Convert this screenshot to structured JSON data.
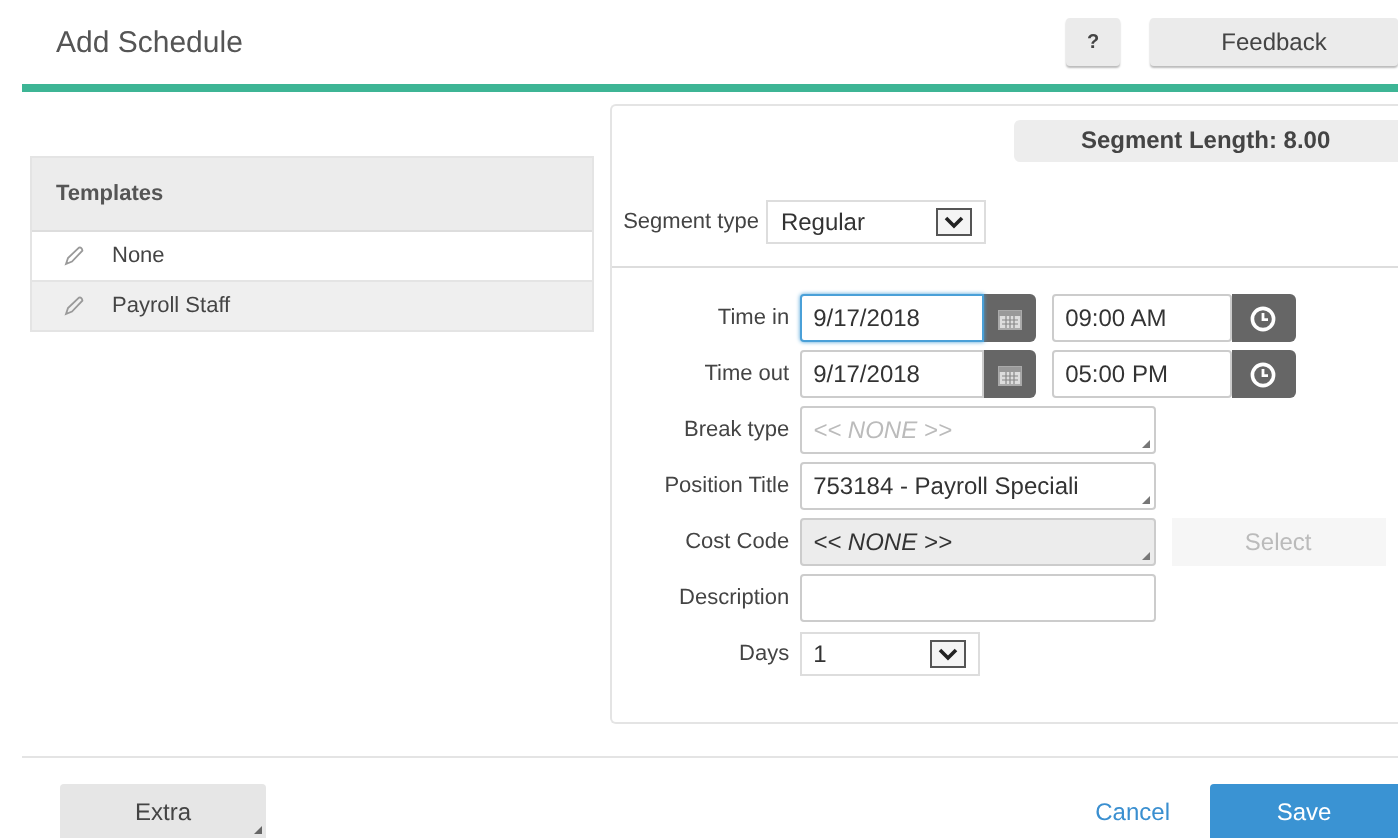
{
  "header": {
    "title": "Add Schedule",
    "help_button": "?",
    "feedback_button": "Feedback"
  },
  "templates": {
    "heading": "Templates",
    "items": [
      {
        "label": "None",
        "highlighted": true
      },
      {
        "label": "Payroll Staff",
        "highlighted": false
      }
    ]
  },
  "form": {
    "segment_length": "Segment Length: 8.00",
    "segment_type": {
      "label": "Segment type",
      "value": "Regular"
    },
    "rows": [
      {
        "kind": "datetime",
        "label": "Time in",
        "date": "9/17/2018",
        "time": "09:00 AM",
        "focused": true
      },
      {
        "kind": "datetime",
        "label": "Time out",
        "date": "9/17/2018",
        "time": "05:00 PM",
        "focused": false
      },
      {
        "kind": "lookup",
        "label": "Break type",
        "placeholder": "<< NONE >>",
        "disabled": false
      },
      {
        "kind": "lookup",
        "label": "Position Title",
        "value": "753184 - Payroll Speciali",
        "disabled": false
      },
      {
        "kind": "lookup",
        "label": "Cost Code",
        "value": "<< NONE >>",
        "disabled": true,
        "button": {
          "label": "Select",
          "disabled": true
        }
      },
      {
        "kind": "text",
        "label": "Description"
      },
      {
        "kind": "select",
        "label": "Days",
        "value": "1"
      }
    ]
  },
  "footer": {
    "extra_button": "Extra",
    "cancel_link": "Cancel",
    "save_button": "Save"
  }
}
